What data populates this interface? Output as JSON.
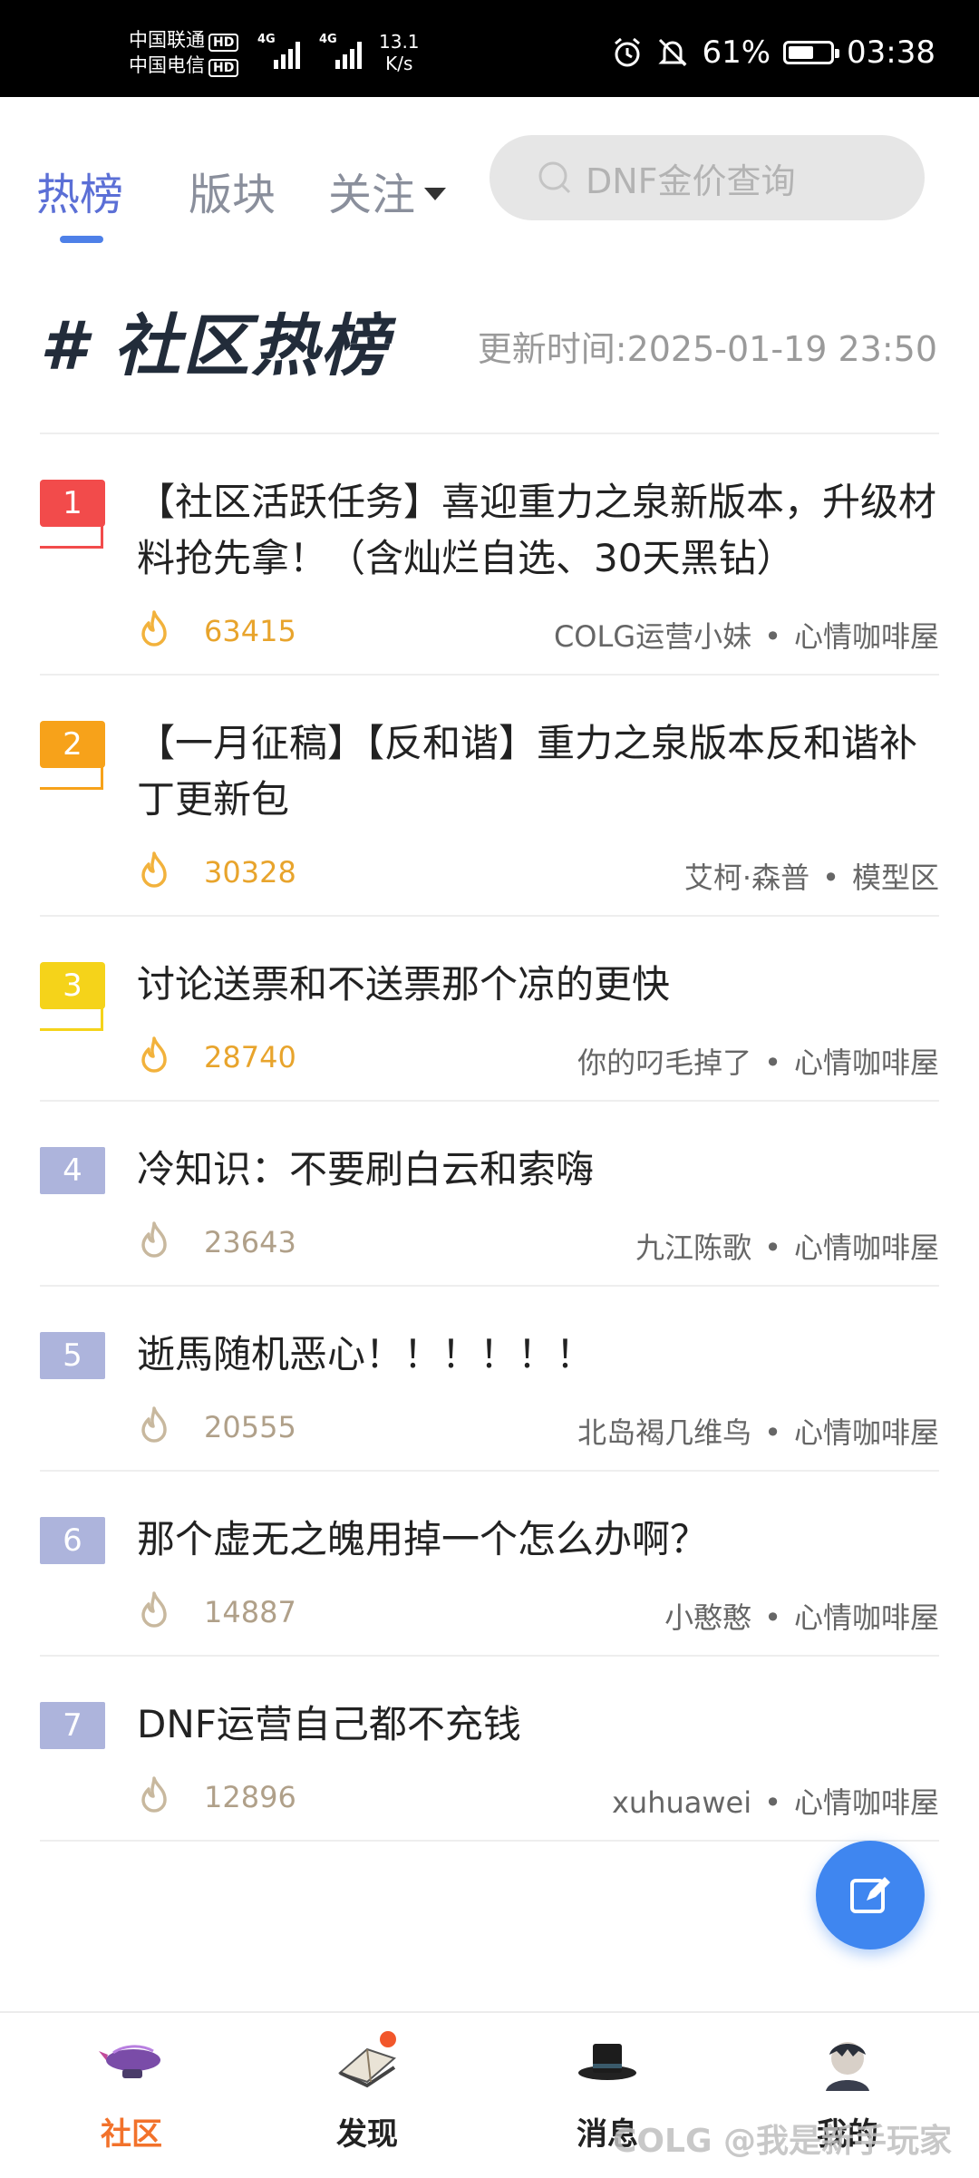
{
  "status_bar": {
    "carrier_1": "中国联通",
    "carrier_2": "中国电信",
    "hd": "HD",
    "network_1": "4G",
    "network_2": "4G",
    "net_speed_value": "13.1",
    "net_speed_unit": "K/s",
    "battery_percent": "61%",
    "battery_level": 0.61,
    "time": "03:38"
  },
  "top_nav": {
    "tabs": [
      {
        "label": "热榜",
        "active": true
      },
      {
        "label": "版块",
        "active": false
      },
      {
        "label": "关注",
        "active": false
      }
    ],
    "search_placeholder": "DNF金价查询"
  },
  "header": {
    "title": "# 社区热榜",
    "update_time": "更新时间:2025-01-19 23:50"
  },
  "list": [
    {
      "rank": "1",
      "title": "【社区活跃任务】喜迎重力之泉新版本，升级材料抢先拿！（含灿烂自选、30天黑钻）",
      "heat": "63415",
      "author": "COLG运营小妹",
      "board": "心情咖啡屋"
    },
    {
      "rank": "2",
      "title": "【一月征稿】【反和谐】重力之泉版本反和谐补丁更新包",
      "heat": "30328",
      "author": "艾柯·森普",
      "board": "模型区"
    },
    {
      "rank": "3",
      "title": "讨论送票和不送票那个凉的更快",
      "heat": "28740",
      "author": "你的叼毛掉了",
      "board": "心情咖啡屋"
    },
    {
      "rank": "4",
      "title": "冷知识：不要刷白云和索嗨",
      "heat": "23643",
      "author": "九江陈歌",
      "board": "心情咖啡屋"
    },
    {
      "rank": "5",
      "title": "逝馬随机恶心！！！！！！",
      "heat": "20555",
      "author": "北岛褐几维鸟",
      "board": "心情咖啡屋"
    },
    {
      "rank": "6",
      "title": "那个虚无之魄用掉一个怎么办啊？",
      "heat": "14887",
      "author": "小憨憨",
      "board": "心情咖啡屋"
    },
    {
      "rank": "7",
      "title": "DNF运营自己都不充钱",
      "heat": "12896",
      "author": "xuhuawei",
      "board": "心情咖啡屋"
    }
  ],
  "separator": "•",
  "bottom_nav": [
    {
      "label": "社区",
      "icon": "airship-icon"
    },
    {
      "label": "发现",
      "icon": "book-icon"
    },
    {
      "label": "消息",
      "icon": "top-hat-icon"
    },
    {
      "label": "我的",
      "icon": "avatar-icon"
    }
  ],
  "watermark": "COLG @我是新手玩家",
  "colors": {
    "accent": "#5b6fd6",
    "rank_1": "#f24b4b",
    "rank_2": "#f7a21a",
    "rank_3": "#f5d31a",
    "rank_other": "#adb4dc",
    "heat_top": "#e8a42c",
    "fab": "#3f86f0",
    "bottom_active": "#f2722b"
  }
}
